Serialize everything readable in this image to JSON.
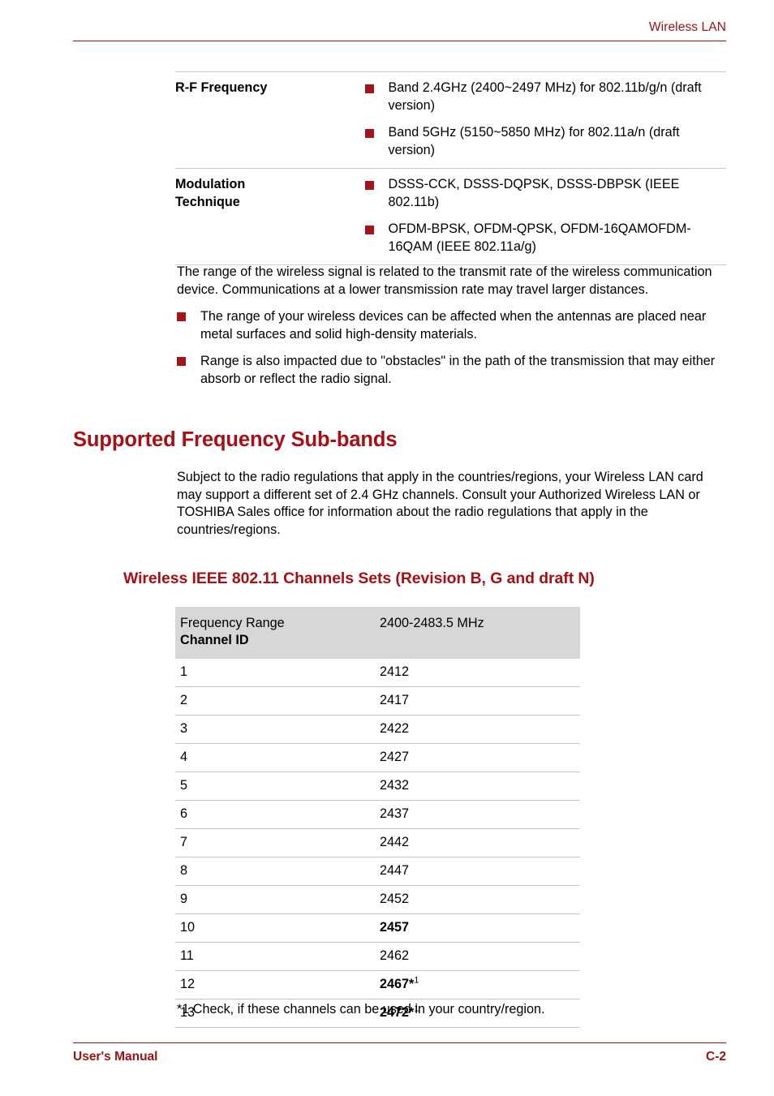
{
  "page": {
    "running_header": "Wireless LAN",
    "footer_left": "User's Manual",
    "footer_right": "C-2",
    "accent_color": "#AA0E13",
    "bullet_color": "#A3151A",
    "table_header_bg": "#D7D7D7"
  },
  "spec_table": {
    "rows": [
      {
        "label": "R-F Frequency",
        "bullets": [
          "Band 2.4GHz (2400~2497 MHz) for 802.11b/g/n (draft version)",
          "Band 5GHz (5150~5850 MHz) for 802.11a/n (draft version)"
        ]
      },
      {
        "label": "Modulation Technique",
        "label_line1": "Modulation",
        "label_line2": "Technique",
        "bullets": [
          "DSSS-CCK, DSSS-DQPSK, DSSS-DBPSK (IEEE 802.11b)",
          "OFDM-BPSK, OFDM-QPSK, OFDM-16QAMOFDM-16QAM (IEEE 802.11a/g)"
        ]
      }
    ]
  },
  "range_section": {
    "paragraph": "The range of the wireless signal is related to the transmit rate of the wireless communication device. Communications at a lower transmission rate may travel larger distances.",
    "bullets": [
      "The range of your wireless devices can be affected when the antennas are placed near metal surfaces and solid high-density materials.",
      "Range is also impacted due to \"obstacles\" in the path of the transmission that may either absorb or reflect the radio signal."
    ]
  },
  "sub_bands_section": {
    "heading": "Supported Frequency Sub-bands",
    "paragraph": "Subject to the radio regulations that apply in the countries/regions, your Wireless LAN card may support a different set of 2.4 GHz channels. Consult your Authorized Wireless LAN or TOSHIBA Sales office for information about the radio regulations that apply in the countries/regions.",
    "table_heading": "Wireless IEEE 802.11 Channels Sets (Revision B, G and draft N)",
    "footnote": "*1 Check, if these channels can be used in your country/region."
  },
  "channel_table": {
    "header": {
      "col1_line1": "Frequency Range",
      "col1_line2": "Channel ID",
      "col2": "2400-2483.5 MHz"
    },
    "rows": [
      {
        "channel": "1",
        "frequency": "2412",
        "bold": false,
        "footnote": ""
      },
      {
        "channel": "2",
        "frequency": "2417",
        "bold": false,
        "footnote": ""
      },
      {
        "channel": "3",
        "frequency": "2422",
        "bold": false,
        "footnote": ""
      },
      {
        "channel": "4",
        "frequency": "2427",
        "bold": false,
        "footnote": ""
      },
      {
        "channel": "5",
        "frequency": "2432",
        "bold": false,
        "footnote": ""
      },
      {
        "channel": "6",
        "frequency": "2437",
        "bold": false,
        "footnote": ""
      },
      {
        "channel": "7",
        "frequency": "2442",
        "bold": false,
        "footnote": ""
      },
      {
        "channel": "8",
        "frequency": "2447",
        "bold": false,
        "footnote": ""
      },
      {
        "channel": "9",
        "frequency": "2452",
        "bold": false,
        "footnote": ""
      },
      {
        "channel": "10",
        "frequency": "2457",
        "bold": true,
        "footnote": ""
      },
      {
        "channel": "11",
        "frequency": "2462",
        "bold": false,
        "footnote": ""
      },
      {
        "channel": "12",
        "frequency": "2467",
        "bold": true,
        "footnote": "1"
      },
      {
        "channel": "13",
        "frequency": "2472",
        "bold": true,
        "footnote": "1"
      }
    ]
  }
}
